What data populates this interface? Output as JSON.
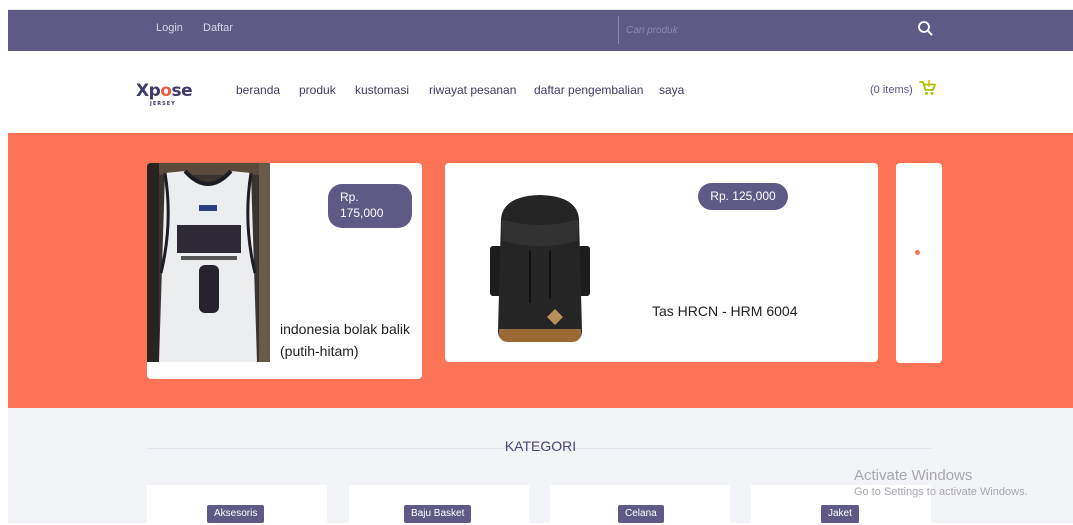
{
  "topbar": {
    "login": "Login",
    "register": "Daftar",
    "search_placeholder": "Cari produk",
    "search_icon": "search-icon"
  },
  "navbar": {
    "logo_text_main": "Xpose",
    "logo_text_sub": "JERSEY",
    "menu": [
      "beranda",
      "produk",
      "kustomasi",
      "riwayat pesanan",
      "daftar pengembalian",
      "saya"
    ],
    "cart_label": "(0 items)",
    "cart_icon": "cart-icon"
  },
  "hero": {
    "products": [
      {
        "price": "Rp. 175,000",
        "name": "indonesia bolak balik (putih-hitam)",
        "image": "jersey-image"
      },
      {
        "price": "Rp. 125,000",
        "name": "Tas HRCN - HRM 6004",
        "image": "backpack-image"
      }
    ]
  },
  "kategori": {
    "title": "KATEGORI",
    "items": [
      "Aksesoris",
      "Baju Basket",
      "Celana",
      "Jaket"
    ]
  },
  "watermark": {
    "line1": "Activate Windows",
    "line2": "Go to Settings to activate Windows."
  },
  "colors": {
    "brand_purple": "#5f5a85",
    "accent_coral": "#fd7356",
    "section_bg": "#f3f4f7",
    "cart_icon": "#a4c400"
  }
}
